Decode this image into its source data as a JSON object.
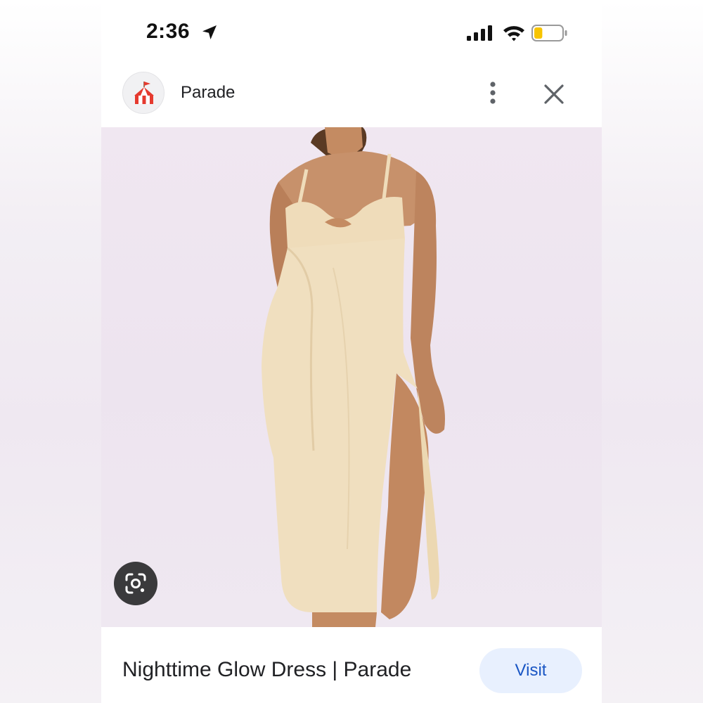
{
  "status_bar": {
    "time": "2:36",
    "location_icon": "location-arrow-icon",
    "signal_icon": "cellular-signal-icon",
    "wifi_icon": "wifi-icon",
    "battery_icon": "battery-icon",
    "battery_level": 0.3,
    "battery_color": "#f7c400"
  },
  "header": {
    "site_name": "Parade",
    "favicon_icon": "circus-tent-icon",
    "more_icon": "more-vertical-icon",
    "close_icon": "close-icon"
  },
  "image": {
    "subject": "model wearing long champagne satin slip dress with cutout and side slit",
    "lens_icon": "google-lens-icon"
  },
  "result": {
    "title": "Nighttime Glow Dress | Parade",
    "visit_label": "Visit"
  },
  "colors": {
    "accent": "#1a56c4",
    "visit_bg": "#e8f0fe",
    "photo_bg": "#efe6f0",
    "dress": "#f0dfbf"
  }
}
